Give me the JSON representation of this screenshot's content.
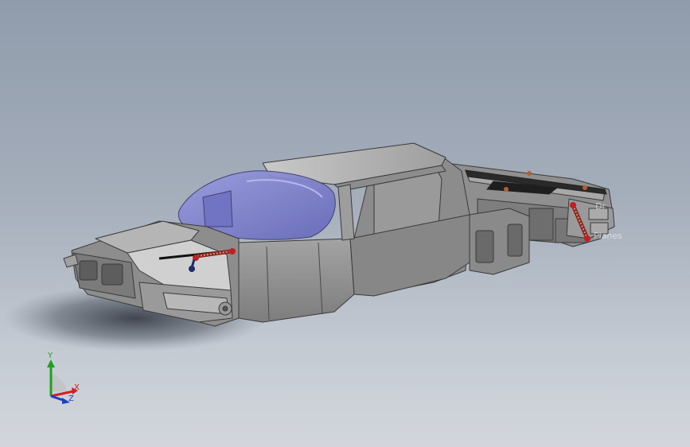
{
  "viewport": {
    "background_top": "#909cac",
    "background_bottom": "#d2d6dc"
  },
  "model": {
    "body_color": "#8a8a8a",
    "canopy_color": "#7c7fd1",
    "suspension_accent": "#8b2020"
  },
  "triad": {
    "x_label": "X",
    "y_label": "Y",
    "z_label": "Z",
    "x_color": "#d02020",
    "y_color": "#20a020",
    "z_color": "#2040c0"
  },
  "faint_labels": {
    "a": "Dr",
    "b": "Planes"
  }
}
